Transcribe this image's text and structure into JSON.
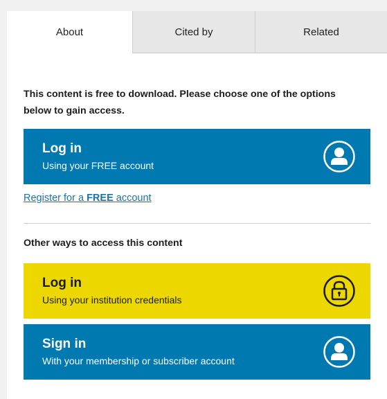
{
  "tabs": [
    {
      "label": "About",
      "active": true
    },
    {
      "label": "Cited by",
      "active": false
    },
    {
      "label": "Related",
      "active": false
    }
  ],
  "intro_text": "This content is free to download. Please choose one of the options below to gain access.",
  "login_free": {
    "title": "Log in",
    "subtitle": "Using your FREE account",
    "icon": "user-icon",
    "color": "#0079b0"
  },
  "register": {
    "prefix": "Register for a ",
    "bold": "FREE",
    "suffix": " account"
  },
  "other_heading": "Other ways to access this content",
  "login_institution": {
    "title": "Log in",
    "subtitle": "Using your institution credentials",
    "icon": "lock-icon",
    "color": "#ecd800"
  },
  "sign_in": {
    "title": "Sign in",
    "subtitle": "With your membership or subscriber account",
    "icon": "user-icon",
    "color": "#0079b0"
  }
}
